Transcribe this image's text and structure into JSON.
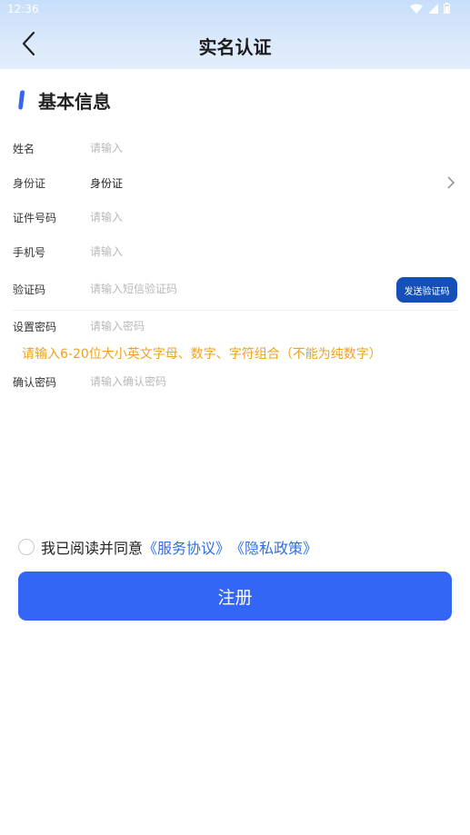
{
  "status_bar": {
    "time": "12:36"
  },
  "header": {
    "title": "实名认证"
  },
  "section": {
    "title": "基本信息"
  },
  "form": {
    "name": {
      "label": "姓名",
      "placeholder": "请输入"
    },
    "id_type": {
      "label": "身份证",
      "value": "身份证"
    },
    "id_number": {
      "label": "证件号码",
      "placeholder": "请输入"
    },
    "phone": {
      "label": "手机号",
      "placeholder": "请输入"
    },
    "code": {
      "label": "验证码",
      "placeholder": "请输入短信验证码",
      "send_button": "发送验证码"
    },
    "password": {
      "label": "设置密码",
      "placeholder": "请输入密码"
    },
    "password_hint": "请输入6-20位大小英文字母、数字、字符组合（不能为纯数字）",
    "confirm": {
      "label": "确认密码",
      "placeholder": "请输入确认密码"
    }
  },
  "agreement": {
    "text": "我已阅读并同意",
    "service_link": "《服务协议》",
    "privacy_link": "《隐私政策》"
  },
  "register_button": "注册",
  "colors": {
    "primary": "#3466f6",
    "send_button": "#1450b8",
    "hint": "#f0a21e",
    "link": "#2f6fe0"
  }
}
